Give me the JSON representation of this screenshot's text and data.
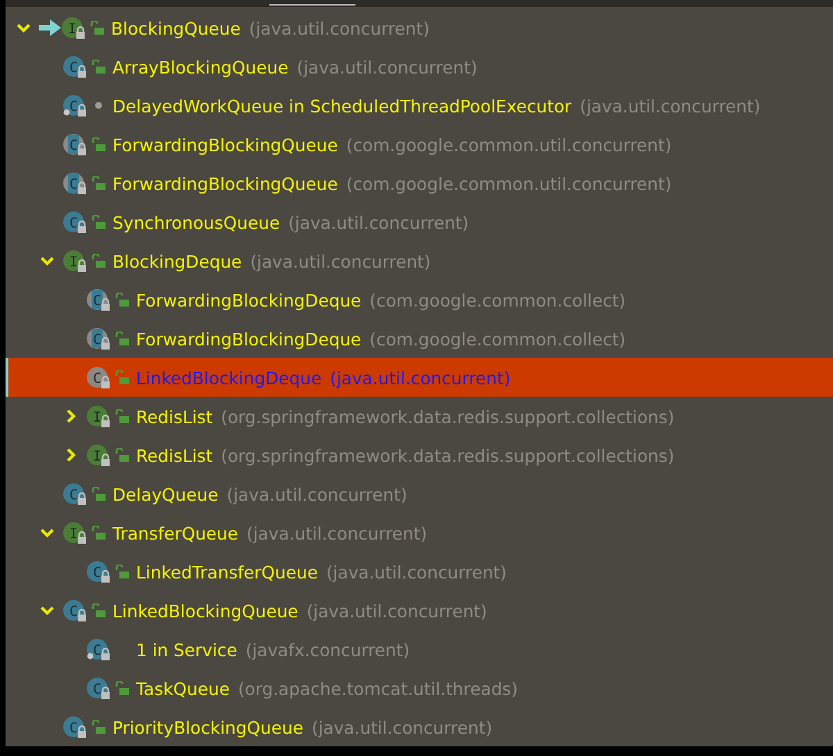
{
  "tree": [
    {
      "name": "BlockingQueue",
      "package": "(java.util.concurrent)",
      "kind": "interface",
      "letter": "I",
      "public": true,
      "package_private": false,
      "selected": false,
      "expanded": true,
      "children": [
        {
          "name": "ArrayBlockingQueue",
          "package": "(java.util.concurrent)",
          "kind": "class",
          "letter": "C",
          "public": true,
          "package_private": false,
          "selected": false
        },
        {
          "name": "DelayedWorkQueue in ScheduledThreadPoolExecutor",
          "package": "(java.util.concurrent)",
          "kind": "inner",
          "letter": "C",
          "public": false,
          "package_private": true,
          "selected": false
        },
        {
          "name": "ForwardingBlockingQueue",
          "package": "(com.google.common.util.concurrent)",
          "kind": "abstract",
          "letter": "C",
          "public": true,
          "package_private": false,
          "selected": false
        },
        {
          "name": "ForwardingBlockingQueue",
          "package": "(com.google.common.util.concurrent)",
          "kind": "abstract",
          "letter": "C",
          "public": true,
          "package_private": false,
          "selected": false
        },
        {
          "name": "SynchronousQueue",
          "package": "(java.util.concurrent)",
          "kind": "class",
          "letter": "C",
          "public": true,
          "package_private": false,
          "selected": false
        },
        {
          "name": "BlockingDeque",
          "package": "(java.util.concurrent)",
          "kind": "interface",
          "letter": "I",
          "public": true,
          "package_private": false,
          "selected": false,
          "expanded": true,
          "children": [
            {
              "name": "ForwardingBlockingDeque",
              "package": "(com.google.common.collect)",
              "kind": "abstract",
              "letter": "C",
              "public": true,
              "package_private": false,
              "selected": false
            },
            {
              "name": "ForwardingBlockingDeque",
              "package": "(com.google.common.collect)",
              "kind": "abstract",
              "letter": "C",
              "public": true,
              "package_private": false,
              "selected": false
            },
            {
              "name": "LinkedBlockingDeque",
              "package": "(java.util.concurrent)",
              "kind": "class",
              "letter": "C",
              "public": true,
              "package_private": false,
              "selected": true
            },
            {
              "name": "RedisList",
              "package": "(org.springframework.data.redis.support.collections)",
              "kind": "interface",
              "letter": "I",
              "public": true,
              "package_private": false,
              "selected": false,
              "expanded": false
            },
            {
              "name": "RedisList",
              "package": "(org.springframework.data.redis.support.collections)",
              "kind": "interface",
              "letter": "I",
              "public": true,
              "package_private": false,
              "selected": false,
              "expanded": false
            }
          ]
        },
        {
          "name": "DelayQueue",
          "package": "(java.util.concurrent)",
          "kind": "class",
          "letter": "C",
          "public": true,
          "package_private": false,
          "selected": false
        },
        {
          "name": "TransferQueue",
          "package": "(java.util.concurrent)",
          "kind": "interface",
          "letter": "I",
          "public": true,
          "package_private": false,
          "selected": false,
          "expanded": true,
          "children": [
            {
              "name": "LinkedTransferQueue",
              "package": "(java.util.concurrent)",
              "kind": "class",
              "letter": "C",
              "public": true,
              "package_private": false,
              "selected": false
            }
          ]
        },
        {
          "name": "LinkedBlockingQueue",
          "package": "(java.util.concurrent)",
          "kind": "class",
          "letter": "C",
          "public": true,
          "package_private": false,
          "selected": false,
          "expanded": true,
          "children": [
            {
              "name": "1 in Service",
              "package": "(javafx.concurrent)",
              "kind": "inner",
              "letter": "C",
              "public": false,
              "package_private": false,
              "selected": false
            },
            {
              "name": "TaskQueue",
              "package": "(org.apache.tomcat.util.threads)",
              "kind": "class",
              "letter": "C",
              "public": true,
              "package_private": false,
              "selected": false
            }
          ]
        },
        {
          "name": "PriorityBlockingQueue",
          "package": "(java.util.concurrent)",
          "kind": "class",
          "letter": "C",
          "public": true,
          "package_private": false,
          "selected": false
        }
      ]
    }
  ]
}
